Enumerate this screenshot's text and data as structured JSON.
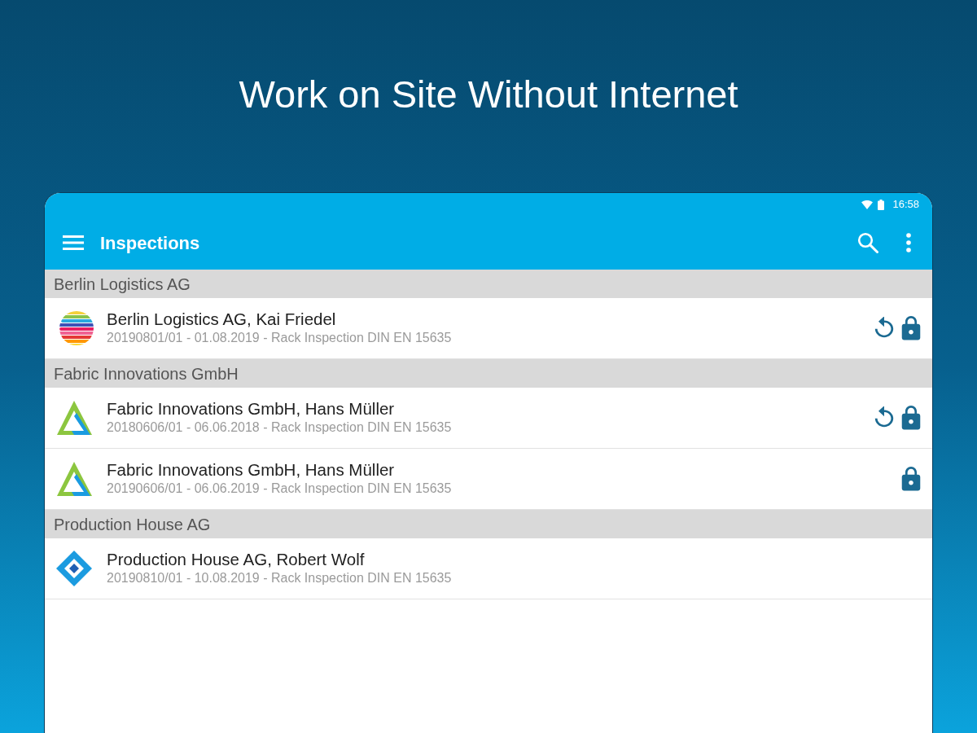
{
  "headline": "Work on Site Without Internet",
  "status_bar": {
    "time": "16:58"
  },
  "app_bar": {
    "title": "Inspections"
  },
  "groups": [
    {
      "name": "Berlin Logistics AG",
      "items": [
        {
          "kind": "stripes",
          "title": "Berlin Logistics AG, Kai Friedel",
          "subtitle": "20190801/01 - 01.08.2019 - Rack Inspection DIN EN 15635",
          "sync_pending": true,
          "locked": true
        }
      ]
    },
    {
      "name": "Fabric Innovations GmbH",
      "items": [
        {
          "kind": "triangle",
          "title": "Fabric Innovations GmbH, Hans Müller",
          "subtitle": "20180606/01 - 06.06.2018 - Rack Inspection DIN EN 15635",
          "sync_pending": true,
          "locked": true
        },
        {
          "kind": "triangle",
          "title": "Fabric Innovations GmbH, Hans Müller",
          "subtitle": "20190606/01 - 06.06.2019 - Rack Inspection DIN EN 15635",
          "sync_pending": false,
          "locked": true
        }
      ]
    },
    {
      "name": "Production House AG",
      "items": [
        {
          "kind": "diamond",
          "title": "Production House AG, Robert Wolf",
          "subtitle": "20190810/01 - 10.08.2019 - Rack Inspection DIN EN 15635",
          "sync_pending": false,
          "locked": false
        }
      ]
    }
  ]
}
